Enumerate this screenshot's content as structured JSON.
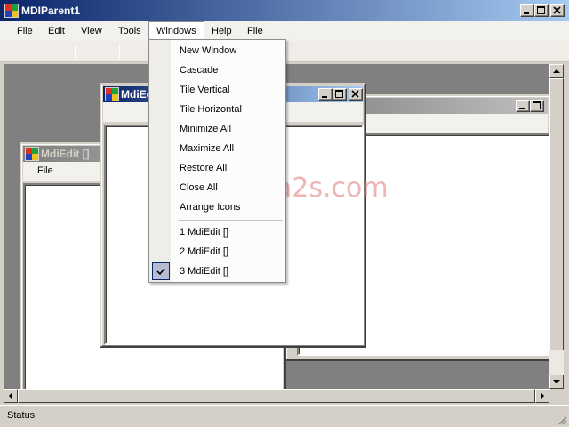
{
  "window": {
    "title": "MDIParent1"
  },
  "menubar": {
    "items": [
      "File",
      "Edit",
      "View",
      "Tools",
      "Windows",
      "Help",
      "File"
    ]
  },
  "windows_menu": {
    "items": [
      "New Window",
      "Cascade",
      "Tile Vertical",
      "Tile Horizontal",
      "Minimize All",
      "Maximize All",
      "Restore All",
      "Close All",
      "Arrange Icons"
    ],
    "windows": [
      "1 MdiEdit []",
      "2 MdiEdit []",
      "3 MdiEdit []"
    ],
    "checked_index": 2
  },
  "children": {
    "left": {
      "title": "MdiEdit []",
      "menu": "File"
    },
    "front": {
      "title": "MdiEd"
    }
  },
  "watermark": "www.java2s.com",
  "status": {
    "text": "Status"
  }
}
